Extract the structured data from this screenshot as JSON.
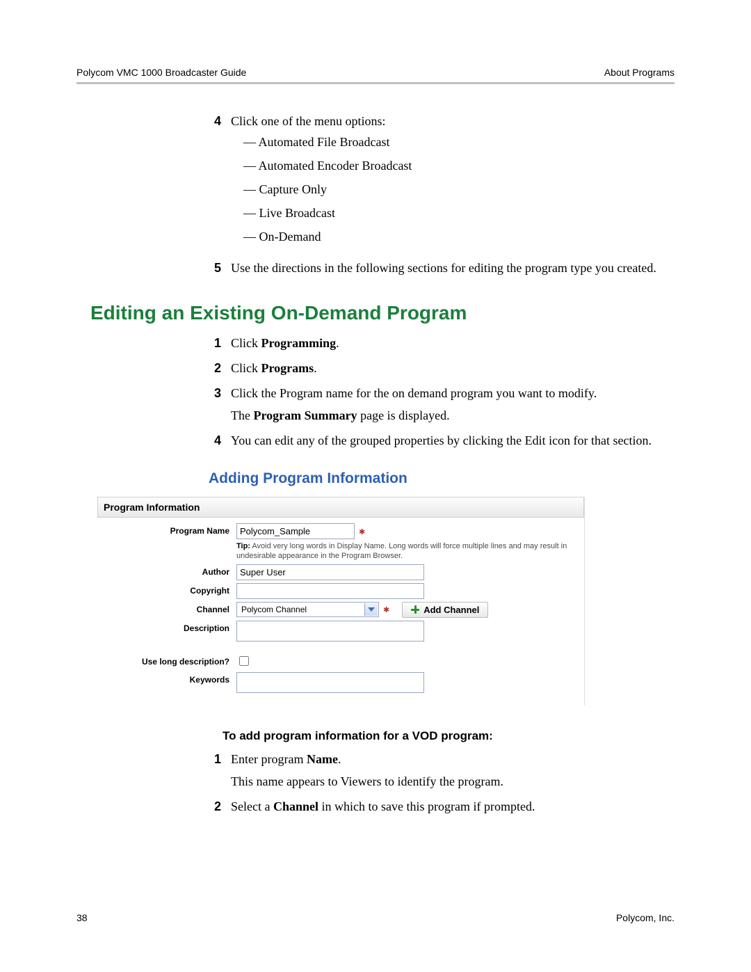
{
  "header": {
    "left": "Polycom VMC 1000 Broadcaster Guide",
    "right": "About Programs"
  },
  "top_list": {
    "item4": {
      "num": "4",
      "text": "Click one of the menu options:",
      "options": [
        "Automated File Broadcast",
        "Automated Encoder Broadcast",
        "Capture Only",
        "Live Broadcast",
        "On-Demand"
      ]
    },
    "item5": {
      "num": "5",
      "text": "Use the directions in the following sections for editing the program type you created."
    }
  },
  "section_title": "Editing an Existing On-Demand Program",
  "steps": {
    "s1": {
      "num": "1",
      "pre": "Click ",
      "bold": "Programming",
      "post": "."
    },
    "s2": {
      "num": "2",
      "pre": "Click ",
      "bold": "Programs",
      "post": "."
    },
    "s3": {
      "num": "3",
      "line": "Click the Program name for the on demand program you want to modify.",
      "extra_pre": "The ",
      "extra_bold": "Program Summary",
      "extra_post": " page is displayed."
    },
    "s4": {
      "num": "4",
      "line": "You can edit any of the grouped properties by clicking the Edit icon for that section."
    }
  },
  "subsection_title": "Adding Program Information",
  "panel": {
    "title": "Program Information",
    "labels": {
      "program_name": "Program Name",
      "author": "Author",
      "copyright": "Copyright",
      "channel": "Channel",
      "description": "Description",
      "long_desc": "Use long description?",
      "keywords": "Keywords"
    },
    "values": {
      "program_name": "Polycom_Sample",
      "author": "Super User",
      "copyright": "",
      "channel": "Polycom Channel",
      "description": "",
      "keywords": ""
    },
    "tip_label": "Tip:",
    "tip_text": " Avoid very long words in Display Name. Long words will force multiple lines and may result in undesirable appearance in the Program Browser.",
    "add_channel": "Add Channel"
  },
  "instr_heading": "To add program information for a VOD program:",
  "instr": {
    "i1": {
      "num": "1",
      "pre": "Enter program ",
      "bold": "Name",
      "post": ".",
      "extra": "This name appears to Viewers to identify the program."
    },
    "i2": {
      "num": "2",
      "pre": "Select a ",
      "bold": "Channel",
      "post": " in which to save this program if prompted."
    }
  },
  "footer": {
    "page": "38",
    "right": "Polycom, Inc."
  }
}
